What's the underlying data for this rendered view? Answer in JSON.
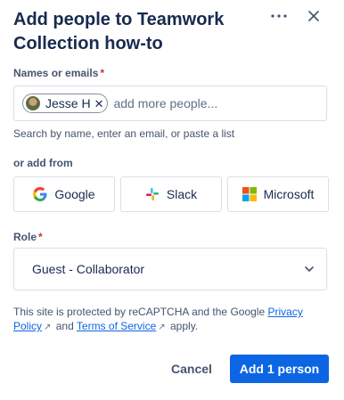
{
  "dialog": {
    "title": "Add people to Teamwork Collection how-to",
    "more_icon": "more-horizontal-icon",
    "close_icon": "close-icon"
  },
  "names": {
    "label": "Names or emails",
    "required_mark": "*",
    "chip_name": "Jesse H",
    "chip_remove": "✕",
    "placeholder": "add more people...",
    "helper": "Search by name, enter an email, or paste a list"
  },
  "sources": {
    "label": "or add from",
    "items": [
      {
        "label": "Google",
        "icon": "google-icon"
      },
      {
        "label": "Slack",
        "icon": "slack-icon"
      },
      {
        "label": "Microsoft",
        "icon": "microsoft-icon"
      }
    ]
  },
  "role": {
    "label": "Role",
    "required_mark": "*",
    "value": "Guest - Collaborator"
  },
  "legal": {
    "prefix": "This site is protected by reCAPTCHA and the Google",
    "privacy_link": "Privacy Policy",
    "and": "and",
    "terms_link": "Terms of Service",
    "suffix": "apply.",
    "external_glyph": "↗"
  },
  "footer": {
    "cancel": "Cancel",
    "submit": "Add 1 person"
  },
  "colors": {
    "primary": "#0c66e4",
    "required": "#c9372c",
    "text": "#172b4d",
    "subtle_text": "#44546f",
    "border": "#dcdfe4"
  }
}
